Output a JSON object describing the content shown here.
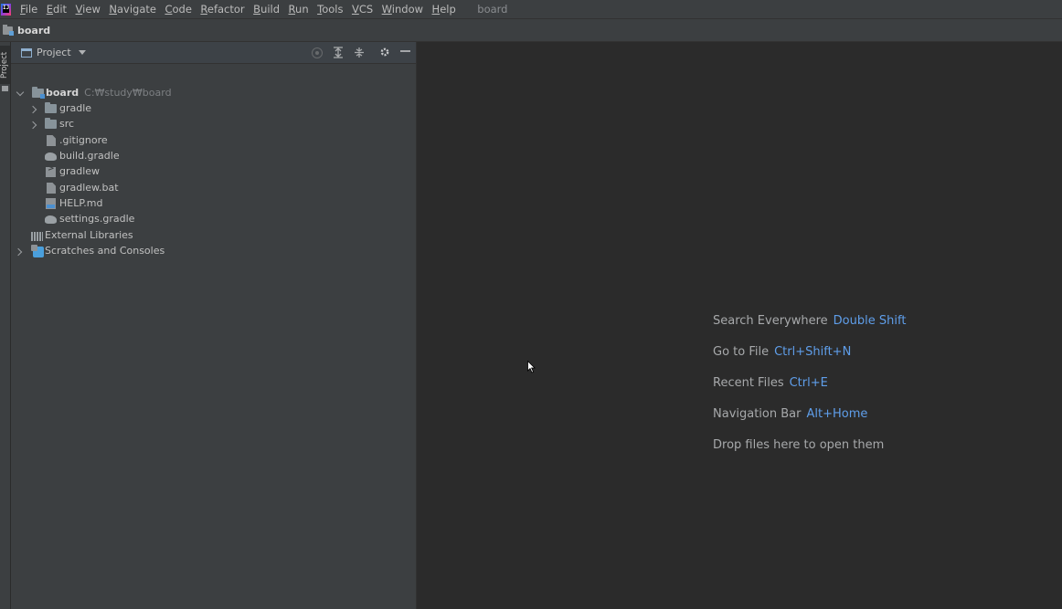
{
  "menubar": {
    "logo_text": "IJ",
    "items": [
      {
        "label_u": "F",
        "label_rest": "ile"
      },
      {
        "label_u": "E",
        "label_rest": "dit"
      },
      {
        "label_u": "V",
        "label_rest": "iew"
      },
      {
        "label_u": "N",
        "label_rest": "avigate"
      },
      {
        "label_u": "C",
        "label_rest": "ode"
      },
      {
        "label_u": "R",
        "label_rest": "efactor"
      },
      {
        "label_u": "B",
        "label_rest": "uild"
      },
      {
        "label_u": "R",
        "label_rest": "un"
      },
      {
        "label_u": "T",
        "label_rest": "ools"
      },
      {
        "label_u": "V",
        "label_rest": "CS"
      },
      {
        "label_u": "W",
        "label_rest": "indow"
      },
      {
        "label_u": "H",
        "label_rest": "elp"
      }
    ],
    "window_title": "board"
  },
  "navbar": {
    "crumb": "board"
  },
  "left_strip": {
    "tab_label": "Project"
  },
  "project_panel": {
    "title": "Project",
    "tree": [
      {
        "label": "board",
        "hint": "C:₩study₩board",
        "icon": "module-folder-icon",
        "expanded": true
      },
      {
        "label": "gradle",
        "icon": "folder-icon",
        "expanded": false
      },
      {
        "label": "src",
        "icon": "folder-icon",
        "expanded": false
      },
      {
        "label": ".gitignore",
        "icon": "gitignore-file-icon"
      },
      {
        "label": "build.gradle",
        "icon": "gradle-file-icon"
      },
      {
        "label": "gradlew",
        "icon": "shell-file-icon"
      },
      {
        "label": "gradlew.bat",
        "icon": "bat-file-icon"
      },
      {
        "label": "HELP.md",
        "icon": "markdown-file-icon"
      },
      {
        "label": "settings.gradle",
        "icon": "gradle-file-icon"
      },
      {
        "label": "External Libraries",
        "icon": "libraries-icon"
      },
      {
        "label": "Scratches and Consoles",
        "icon": "scratches-icon",
        "expanded": false
      }
    ]
  },
  "editor": {
    "hints": [
      {
        "text": "Search Everywhere",
        "key": "Double Shift"
      },
      {
        "text": "Go to File",
        "key": "Ctrl+Shift+N"
      },
      {
        "text": "Recent Files",
        "key": "Ctrl+E"
      },
      {
        "text": "Navigation Bar",
        "key": "Alt+Home"
      },
      {
        "text": "Drop files here to open them",
        "key": ""
      }
    ]
  },
  "colors": {
    "background": "#2b2b2b",
    "panel": "#3c3f41",
    "accent_key": "#5f9eea"
  }
}
